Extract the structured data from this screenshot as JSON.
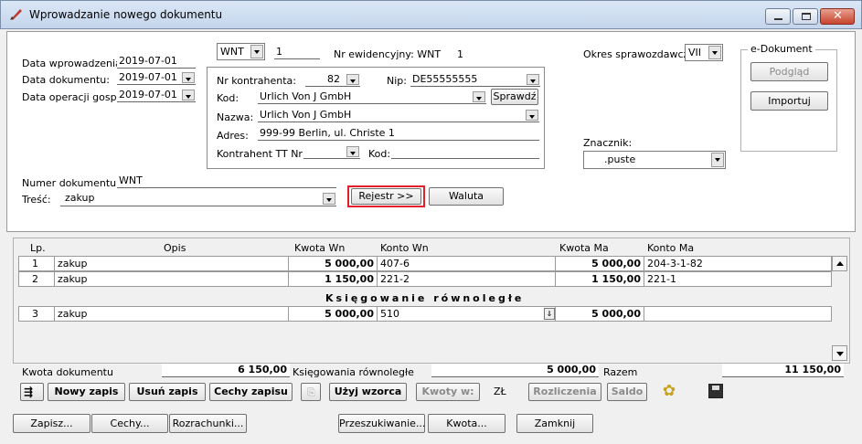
{
  "window": {
    "title": "Wprowadzanie nowego dokumentu"
  },
  "header": {
    "data_wprowadzenia_label": "Data wprowadzenia:",
    "data_wprowadzenia_value": "2019-07-01",
    "data_dokumentu_label": "Data dokumentu:",
    "data_dokumentu_value": "2019-07-01",
    "data_operacji_label": "Data operacji gosp.:",
    "data_operacji_value": "2019-07-01",
    "typ_dokumentu": "WNT",
    "numer_typu": "1",
    "nr_ewidencyjny_label": "Nr ewidencyjny: WNT",
    "nr_ewidencyjny_value": "1",
    "okres_label": "Okres sprawozdawczy:",
    "okres_value": "VII"
  },
  "kontrahent": {
    "nr_label": "Nr kontrahenta:",
    "nr_value": "82",
    "nip_label": "Nip:",
    "nip_value": "DE55555555",
    "kod_label": "Kod:",
    "kod_value": "Urlich Von J GmbH",
    "sprawdz_label": "Sprawdź",
    "nazwa_label": "Nazwa:",
    "nazwa_value": "Urlich Von J GmbH",
    "adres_label": "Adres:",
    "adres_value": "999-99 Berlin, ul. Christe 1",
    "tt_label": "Kontrahent TT Nr:",
    "tt_kod_label": "Kod:"
  },
  "edokument": {
    "group_label": "e-Dokument",
    "podglad_label": "Podgląd",
    "importuj_label": "Importuj"
  },
  "znacznik": {
    "label": "Znacznik:",
    "value": ".puste"
  },
  "dokument": {
    "numer_label": "Numer dokumentu:",
    "numer_value": "WNT",
    "tresc_label": "Treść:",
    "tresc_value": "zakup",
    "rejestr_label": "Rejestr >>",
    "waluta_label": "Waluta"
  },
  "table": {
    "headers": {
      "lp": "Lp.",
      "opis": "Opis",
      "kwota_wn": "Kwota  Wn",
      "konto_wn": "Konto  Wn",
      "kwota_ma": "Kwota Ma",
      "konto_ma": "Konto Ma"
    },
    "rows": [
      {
        "lp": "1",
        "opis": "zakup",
        "kwota_wn": "5 000,00",
        "konto_wn": "407-6",
        "kwota_ma": "5 000,00",
        "konto_ma": "204-3-1-82"
      },
      {
        "lp": "2",
        "opis": "zakup",
        "kwota_wn": "1 150,00",
        "konto_wn": "221-2",
        "kwota_ma": "1 150,00",
        "konto_ma": "221-1"
      }
    ],
    "section_title": "Księgowanie równoległe",
    "parallel_rows": [
      {
        "lp": "3",
        "opis": "zakup",
        "kwota_wn": "5 000,00",
        "konto_wn": "510",
        "kwota_ma": "5 000,00",
        "konto_ma": ""
      }
    ]
  },
  "totals": {
    "kwota_dokumentu_label": "Kwota dokumentu",
    "kwota_dokumentu_value": "6 150,00",
    "ksiegowania_label": "Księgowania równoległe",
    "ksiegowania_value": "5 000,00",
    "razem_label": "Razem",
    "razem_value": "11 150,00"
  },
  "toolbar": {
    "nowy_zapis": "Nowy zapis",
    "usun_zapis": "Usuń zapis",
    "cechy_zapisu": "Cechy zapisu",
    "uzyj_wzorca": "Użyj wzorca",
    "kwoty_wn": "Kwoty w:",
    "currency": "ZŁ",
    "rozliczenia": "Rozliczenia",
    "saldo": "Saldo"
  },
  "bottom": {
    "zapisz": "Zapisz...",
    "cechy": "Cechy...",
    "rozrachunki": "Rozrachunki...",
    "przeszukiwanie": "Przeszukiwanie...",
    "kwota": "Kwota...",
    "zamknij": "Zamknij"
  },
  "colors": {
    "highlight": "#e0202a",
    "titlebar": "#c4d5ec"
  }
}
